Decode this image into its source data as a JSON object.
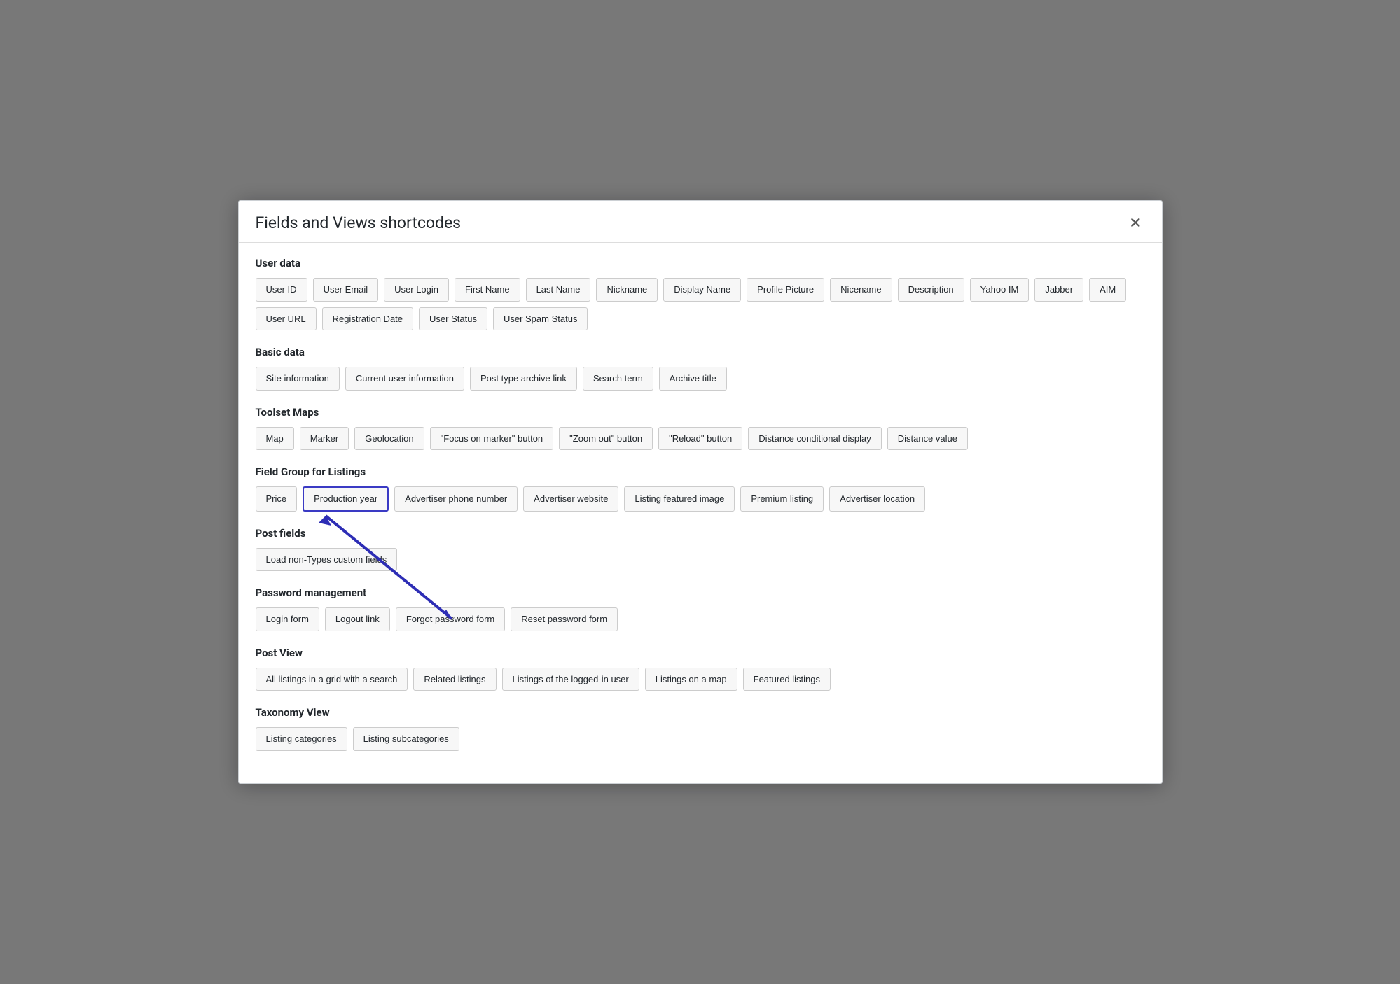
{
  "modal": {
    "title": "Fields and Views shortcodes",
    "close_label": "✕"
  },
  "sections": [
    {
      "id": "user-data",
      "title": "User data",
      "buttons": [
        "User ID",
        "User Email",
        "User Login",
        "First Name",
        "Last Name",
        "Nickname",
        "Display Name",
        "Profile Picture",
        "Nicename",
        "Description",
        "Yahoo IM",
        "Jabber",
        "AIM",
        "User URL",
        "Registration Date",
        "User Status",
        "User Spam Status"
      ]
    },
    {
      "id": "basic-data",
      "title": "Basic data",
      "buttons": [
        "Site information",
        "Current user information",
        "Post type archive link",
        "Search term",
        "Archive title"
      ]
    },
    {
      "id": "toolset-maps",
      "title": "Toolset Maps",
      "buttons": [
        "Map",
        "Marker",
        "Geolocation",
        "\"Focus on marker\" button",
        "\"Zoom out\" button",
        "\"Reload\" button",
        "Distance conditional display",
        "Distance value"
      ]
    },
    {
      "id": "field-group-listings",
      "title": "Field Group for Listings",
      "buttons": [
        "Price",
        "Production year",
        "Advertiser phone number",
        "Advertiser website",
        "Listing featured image",
        "Premium listing",
        "Advertiser location"
      ],
      "highlighted": "Production year"
    },
    {
      "id": "post-fields",
      "title": "Post fields",
      "buttons": [
        "Load non-Types custom fields"
      ]
    },
    {
      "id": "password-management",
      "title": "Password management",
      "buttons": [
        "Login form",
        "Logout link",
        "Forgot password form",
        "Reset password form"
      ]
    },
    {
      "id": "post-view",
      "title": "Post View",
      "buttons": [
        "All listings in a grid with a search",
        "Related listings",
        "Listings of the logged-in user",
        "Listings on a map",
        "Featured listings"
      ]
    },
    {
      "id": "taxonomy-view",
      "title": "Taxonomy View",
      "buttons": [
        "Listing categories",
        "Listing subcategories"
      ]
    }
  ]
}
